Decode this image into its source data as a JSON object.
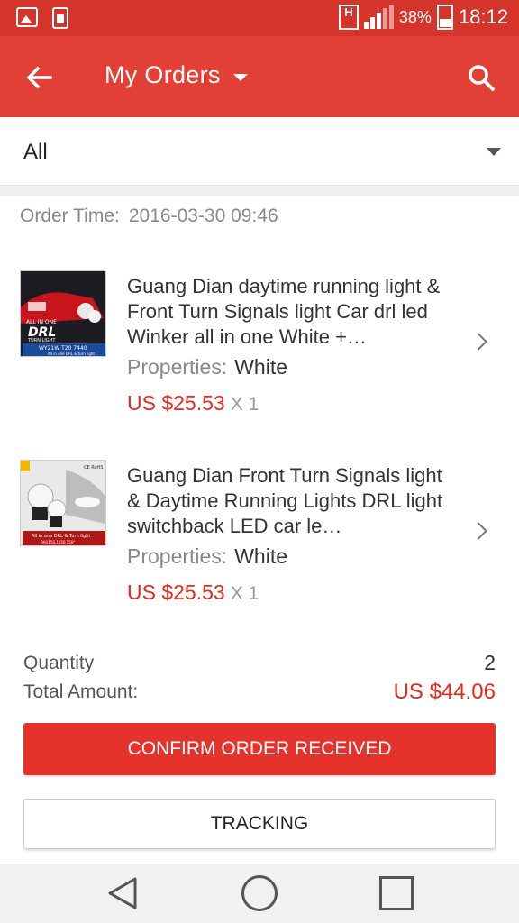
{
  "status_bar": {
    "battery": "38%",
    "time": "18:12",
    "network_badge": "H"
  },
  "app_bar": {
    "title": "My Orders",
    "icons": {
      "back": "arrow-left-icon",
      "caret": "caret-down-icon",
      "search": "search-icon"
    }
  },
  "filter": {
    "selected": "All"
  },
  "order": {
    "time_label": "Order Time:",
    "time_value": "2016-03-30 09:46",
    "items": [
      {
        "title": "Guang Dian daytime running light & Front Turn Signals light Car drl led Winker all in one White +…",
        "props_label": "Properties:",
        "props_value": "White",
        "price": "US $25.53",
        "qty": "X 1",
        "thumb_text": {
          "brand": "ALL IN ONE",
          "main": "DRL",
          "sub": "TURN LIGHT",
          "model": "WY21W T20 7440",
          "note": "All in one DRL & turn light"
        }
      },
      {
        "title": "Guang Dian Front Turn Signals light & Daytime Running Lights DRL light switchback LED car le…",
        "props_label": "Properties:",
        "props_value": "White",
        "price": "US $25.53",
        "qty": "X 1",
        "thumb_text": {
          "note": "All in one DRL & Turn light",
          "model": "BAU15S 1156 150°",
          "badge": "CE RoHS"
        }
      }
    ],
    "quantity_label": "Quantity",
    "quantity_value": "2",
    "total_label": "Total Amount:",
    "total_value": "US $44.06",
    "confirm_label": "CONFIRM ORDER RECEIVED",
    "tracking_label": "TRACKING"
  },
  "colors": {
    "status_bar": "#d5342b",
    "app_bar": "#e23f36",
    "accent_red": "#e4291d",
    "confirm_button": "#e5322b"
  }
}
